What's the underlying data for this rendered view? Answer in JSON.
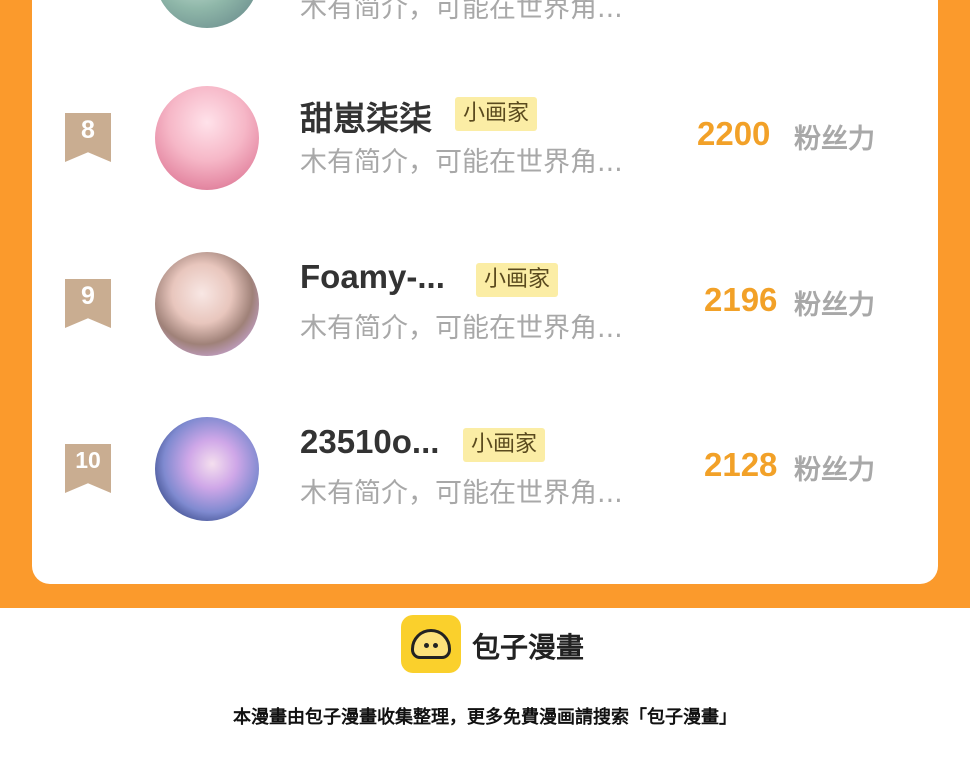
{
  "ranking": {
    "partial_row": {
      "desc": "木有简介，可能在世界角..."
    },
    "rows": [
      {
        "rank": "8",
        "name": "甜崽柒柒",
        "tag": "小画家",
        "desc": "木有简介，可能在世界角...",
        "score": "2200",
        "score_label": "粉丝力"
      },
      {
        "rank": "9",
        "name": "Foamy-...",
        "tag": "小画家",
        "desc": "木有简介，可能在世界角...",
        "score": "2196",
        "score_label": "粉丝力"
      },
      {
        "rank": "10",
        "name": "23510o...",
        "tag": "小画家",
        "desc": "木有简介，可能在世界角...",
        "score": "2128",
        "score_label": "粉丝力"
      }
    ]
  },
  "footer": {
    "logo_text": "包子漫畫",
    "note": "本漫畫由包子漫畫收集整理，更多免費漫画請搜索「包子漫畫」"
  },
  "colors": {
    "accent": "#fb9a2c",
    "score": "#f2a128",
    "tag_bg": "#fbeda5",
    "rank_badge": "#c9ad91"
  }
}
